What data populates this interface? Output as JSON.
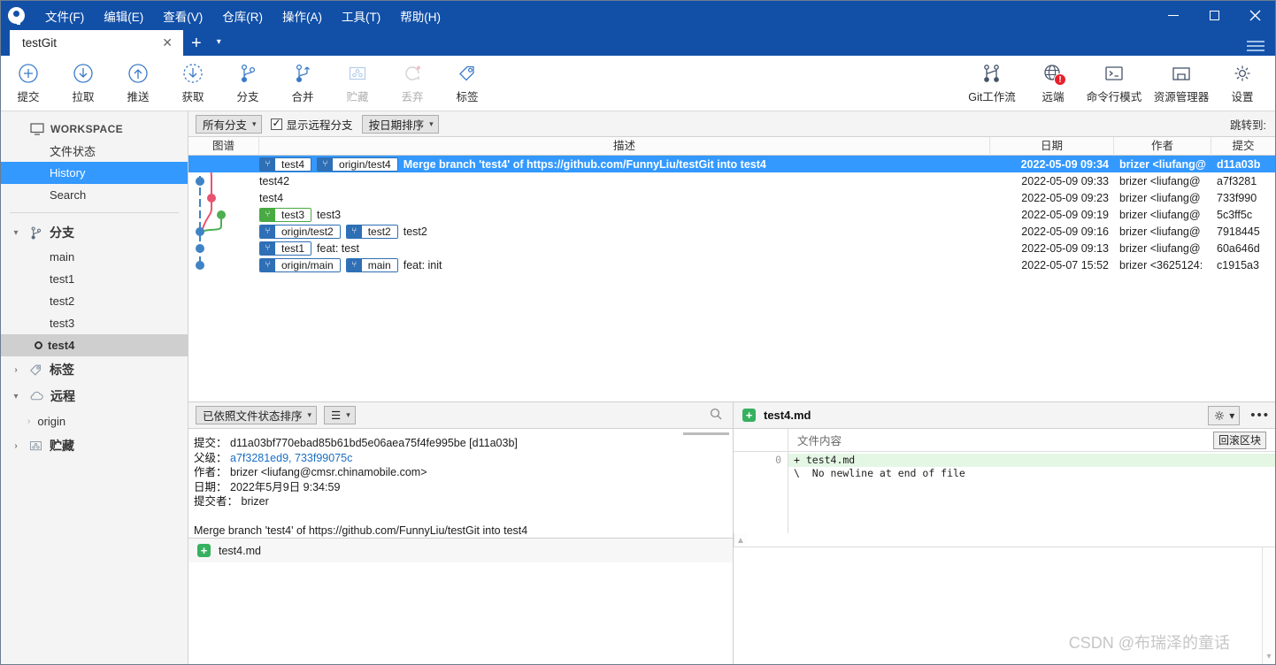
{
  "window": {
    "menus": [
      "文件(F)",
      "编辑(E)",
      "查看(V)",
      "仓库(R)",
      "操作(A)",
      "工具(T)",
      "帮助(H)"
    ],
    "minimize": "—",
    "maximize": "□",
    "close": "✕"
  },
  "tabs": {
    "active": "testGit",
    "close_label": "✕",
    "add_label": "+",
    "dropdown_label": "▾"
  },
  "toolbar": {
    "left": [
      {
        "label": "提交",
        "icon": "commit-plus-icon",
        "disabled": false
      },
      {
        "label": "拉取",
        "icon": "pull-down-arrow-icon",
        "disabled": false
      },
      {
        "label": "推送",
        "icon": "push-up-arrow-icon",
        "disabled": false
      },
      {
        "label": "获取",
        "icon": "fetch-dashed-arrow-icon",
        "disabled": false
      },
      {
        "label": "分支",
        "icon": "branch-icon",
        "disabled": false
      },
      {
        "label": "合并",
        "icon": "merge-icon",
        "disabled": false
      },
      {
        "label": "贮藏",
        "icon": "stash-box-icon",
        "disabled": true
      },
      {
        "label": "丢弃",
        "icon": "discard-refresh-icon",
        "disabled": true
      },
      {
        "label": "标签",
        "icon": "tag-icon",
        "disabled": false
      }
    ],
    "right": [
      {
        "label": "Git工作流",
        "icon": "gitflow-icon",
        "badge": ""
      },
      {
        "label": "远端",
        "icon": "globe-remote-icon",
        "badge": "!"
      },
      {
        "label": "命令行模式",
        "icon": "terminal-icon",
        "badge": ""
      },
      {
        "label": "资源管理器",
        "icon": "folder-explorer-icon",
        "badge": ""
      },
      {
        "label": "设置",
        "icon": "gear-settings-icon",
        "badge": ""
      }
    ]
  },
  "sidebar": {
    "workspace_label": "WORKSPACE",
    "workspace_items": [
      {
        "label": "文件状态",
        "selected": false
      },
      {
        "label": "History",
        "selected": true
      },
      {
        "label": "Search",
        "selected": false
      }
    ],
    "branches_label": "分支",
    "branches": [
      {
        "label": "main",
        "active": false
      },
      {
        "label": "test1",
        "active": false
      },
      {
        "label": "test2",
        "active": false
      },
      {
        "label": "test3",
        "active": false
      },
      {
        "label": "test4",
        "active": true
      }
    ],
    "tags_label": "标签",
    "remotes_label": "远程",
    "remotes": [
      "origin"
    ],
    "stashes_label": "贮藏"
  },
  "history": {
    "filter_branch": "所有分支",
    "show_remote_label": "显示远程分支",
    "show_remote_checked": true,
    "sort_label": "按日期排序",
    "jump_to_label": "跳转到:",
    "columns": {
      "graph": "图谱",
      "description": "描述",
      "date": "日期",
      "author": "作者",
      "commit": "提交"
    },
    "rows": [
      {
        "selected": true,
        "badges": [
          {
            "text": "test4",
            "color": "blue"
          },
          {
            "text": "origin/test4",
            "color": "blue"
          }
        ],
        "message": "Merge branch 'test4' of https://github.com/FunnyLiu/testGit into test4",
        "date": "2022-05-09 09:34",
        "author": "brizer <liufang@",
        "hash": "d11a03b"
      },
      {
        "selected": false,
        "badges": [],
        "message": "test42",
        "date": "2022-05-09 09:33",
        "author": "brizer <liufang@",
        "hash": "a7f3281"
      },
      {
        "selected": false,
        "badges": [],
        "message": "test4",
        "date": "2022-05-09 09:23",
        "author": "brizer <liufang@",
        "hash": "733f990"
      },
      {
        "selected": false,
        "badges": [
          {
            "text": "test3",
            "color": "green"
          }
        ],
        "message": "test3",
        "date": "2022-05-09 09:19",
        "author": "brizer <liufang@",
        "hash": "5c3ff5c"
      },
      {
        "selected": false,
        "badges": [
          {
            "text": "origin/test2",
            "color": "blue"
          },
          {
            "text": "test2",
            "color": "blue"
          }
        ],
        "message": "test2",
        "date": "2022-05-09 09:16",
        "author": "brizer <liufang@",
        "hash": "7918445"
      },
      {
        "selected": false,
        "badges": [
          {
            "text": "test1",
            "color": "blue"
          }
        ],
        "message": "feat: test",
        "date": "2022-05-09 09:13",
        "author": "brizer <liufang@",
        "hash": "60a646d"
      },
      {
        "selected": false,
        "badges": [
          {
            "text": "origin/main",
            "color": "blue"
          },
          {
            "text": "main",
            "color": "blue"
          }
        ],
        "message": "feat: init",
        "date": "2022-05-07 15:52",
        "author": "brizer <3625124:",
        "hash": "c1915a3"
      }
    ]
  },
  "commit_detail": {
    "sort_label": "已依照文件状态排序",
    "view_label": "☰",
    "search_icon": "search-icon",
    "fields": [
      {
        "label": "提交：",
        "value": "d11a03bf770ebad85b61bd5e06aea75f4fe995be [d11a03b]",
        "link": false
      },
      {
        "label": "父级：",
        "value": "a7f3281ed9, 733f99075c",
        "link": true
      },
      {
        "label": "作者：",
        "value": "brizer <liufang@cmsr.chinamobile.com>",
        "link": false
      },
      {
        "label": "日期：",
        "value": "2022年5月9日 9:34:59",
        "link": false
      },
      {
        "label": "提交者：",
        "value": "brizer",
        "link": false
      }
    ],
    "message": "Merge branch 'test4' of https://github.com/FunnyLiu/testGit into test4",
    "file_list": [
      {
        "name": "test4.md",
        "status": "added"
      }
    ]
  },
  "diff": {
    "filename": "test4.md",
    "file_status": "added",
    "gear_label": "⚙",
    "gear_caret": "▾",
    "more_label": "•••",
    "content_column": "文件内容",
    "rollback_label": "回滚区块",
    "lines": [
      {
        "number": "0",
        "text": "+ test4.md",
        "type": "add"
      },
      {
        "number": "",
        "text": "\\  No newline at end of file",
        "type": "meta"
      }
    ]
  },
  "watermark": "CSDN @布瑞泽的童话",
  "colors": {
    "titlebar": "#1250a8",
    "selection": "#3399ff",
    "graph_blue": "#3f83c4",
    "graph_red": "#e8536f",
    "graph_green": "#4caf50",
    "added_green": "#36b15f",
    "badge_red": "#e8202a"
  }
}
